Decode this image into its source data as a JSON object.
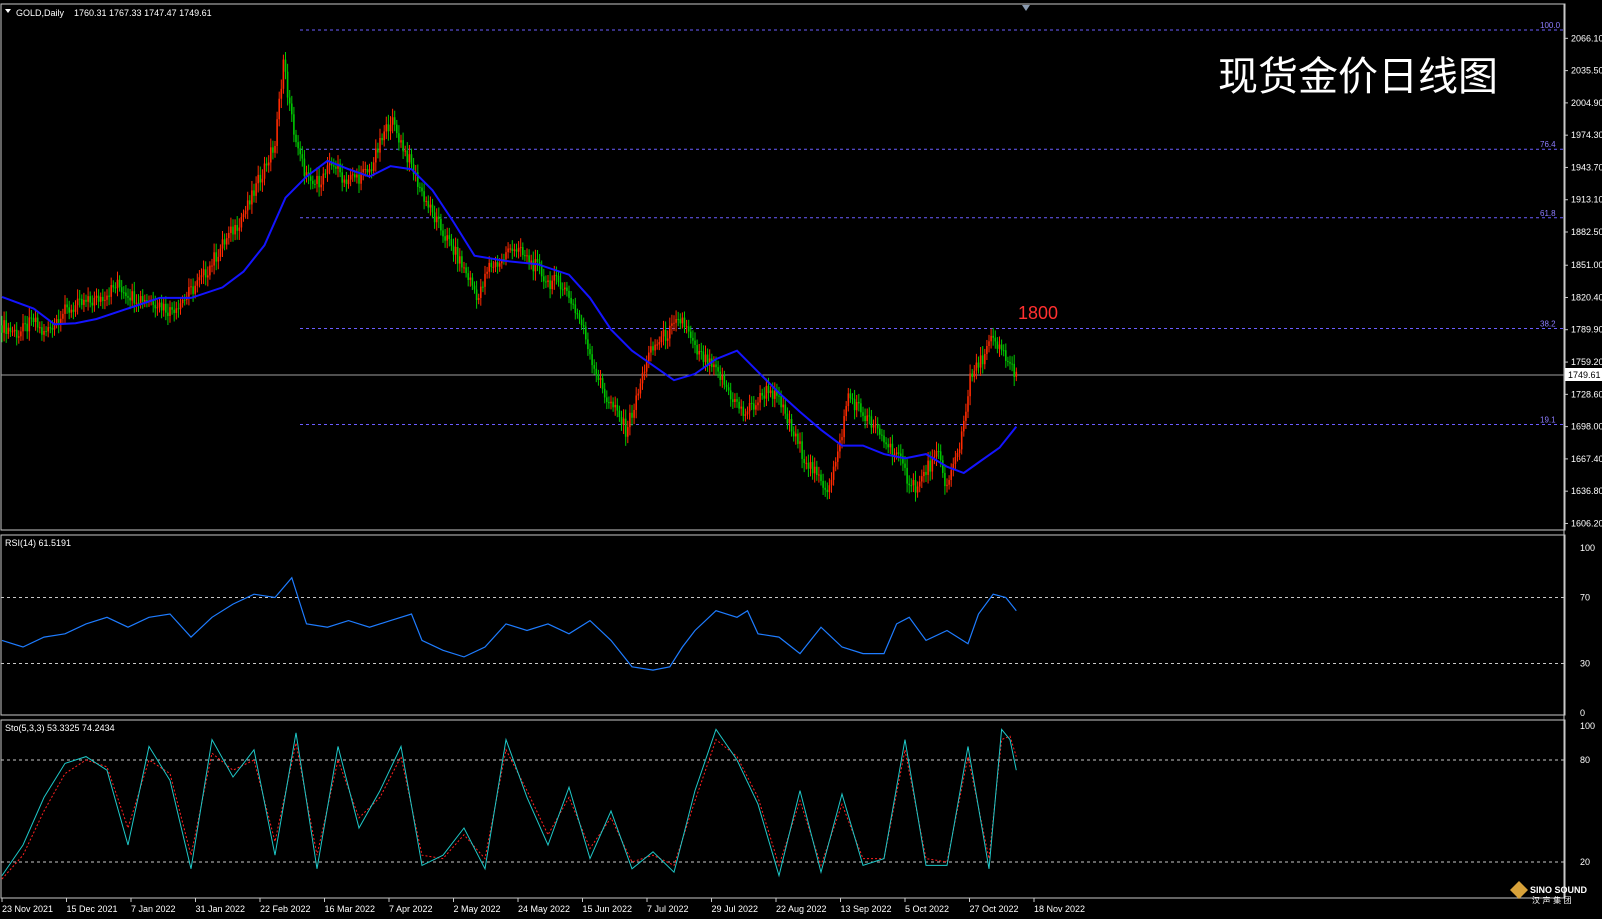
{
  "header": {
    "title": "GOLD,Daily",
    "ohlc": "1760.31 1767.33 1747.47 1749.61"
  },
  "overlay_title": "现货金价日线图",
  "annotation": "1800",
  "current_price": "1749.61",
  "rsi_panel": {
    "label": "RSI(14) 61.5191",
    "levels": [
      "100",
      "70",
      "30",
      "0"
    ]
  },
  "stoch_panel": {
    "label": "Sto(5,3,3) 53.3325 74.2434",
    "levels": [
      "100",
      "80",
      "20"
    ]
  },
  "logo": {
    "mark": "SINO SOUND",
    "subtitle": "汉 声 集 团"
  },
  "colors": {
    "bull": "#ff2a00",
    "bear": "#00c800",
    "ma": "#1414ff",
    "rsi": "#1e7cff",
    "stoch_main": "#1ec8c8",
    "stoch_signal": "#ff2020",
    "fib": "#8d7dff",
    "annotation": "#ff3030"
  },
  "chart_data": [
    {
      "type": "candlestick",
      "title": "GOLD,Daily",
      "x_labels": [
        "23 Nov 2021",
        "15 Dec 2021",
        "7 Jan 2022",
        "31 Jan 2022",
        "22 Feb 2022",
        "16 Mar 2022",
        "7 Apr 2022",
        "2 May 2022",
        "24 May 2022",
        "15 Jun 2022",
        "7 Jul 2022",
        "29 Jul 2022",
        "22 Aug 2022",
        "13 Sep 2022",
        "5 Oct 2022",
        "27 Oct 2022",
        "18 Nov 2022"
      ],
      "y_ticks": [
        "2066.10",
        "2035.50",
        "2004.90",
        "1974.30",
        "1943.70",
        "1913.10",
        "1882.50",
        "1851.00",
        "1820.40",
        "1789.90",
        "1759.20",
        "1728.60",
        "1698.00",
        "1667.40",
        "1636.80",
        "1606.20"
      ],
      "ylim": [
        1600,
        2074
      ],
      "close_path": [
        [
          0,
          1794
        ],
        [
          8,
          1786
        ],
        [
          15,
          1798
        ],
        [
          20,
          1785
        ],
        [
          28,
          1805
        ],
        [
          35,
          1812
        ],
        [
          45,
          1818
        ],
        [
          55,
          1832
        ],
        [
          62,
          1822
        ],
        [
          72,
          1818
        ],
        [
          80,
          1808
        ],
        [
          88,
          1822
        ],
        [
          95,
          1838
        ],
        [
          105,
          1870
        ],
        [
          112,
          1890
        ],
        [
          118,
          1910
        ],
        [
          124,
          1940
        ],
        [
          130,
          1965
        ],
        [
          134,
          2045
        ],
        [
          137,
          2000
        ],
        [
          141,
          1958
        ],
        [
          147,
          1925
        ],
        [
          153,
          1935
        ],
        [
          158,
          1948
        ],
        [
          163,
          1932
        ],
        [
          170,
          1935
        ],
        [
          175,
          1940
        ],
        [
          180,
          1965
        ],
        [
          185,
          1990
        ],
        [
          190,
          1968
        ],
        [
          195,
          1945
        ],
        [
          200,
          1920
        ],
        [
          206,
          1895
        ],
        [
          212,
          1875
        ],
        [
          217,
          1858
        ],
        [
          222,
          1840
        ],
        [
          227,
          1820
        ],
        [
          232,
          1850
        ],
        [
          238,
          1855
        ],
        [
          243,
          1870
        ],
        [
          248,
          1860
        ],
        [
          254,
          1850
        ],
        [
          260,
          1835
        ],
        [
          266,
          1835
        ],
        [
          271,
          1818
        ],
        [
          276,
          1795
        ],
        [
          282,
          1755
        ],
        [
          287,
          1728
        ],
        [
          293,
          1710
        ],
        [
          297,
          1695
        ],
        [
          302,
          1722
        ],
        [
          307,
          1762
        ],
        [
          313,
          1780
        ],
        [
          319,
          1790
        ],
        [
          324,
          1800
        ],
        [
          330,
          1770
        ],
        [
          336,
          1758
        ],
        [
          342,
          1745
        ],
        [
          348,
          1725
        ],
        [
          353,
          1710
        ],
        [
          359,
          1720
        ],
        [
          365,
          1735
        ],
        [
          371,
          1718
        ],
        [
          377,
          1690
        ],
        [
          382,
          1670
        ],
        [
          388,
          1650
        ],
        [
          393,
          1640
        ],
        [
          398,
          1670
        ],
        [
          403,
          1728
        ],
        [
          408,
          1715
        ],
        [
          414,
          1700
        ],
        [
          420,
          1685
        ],
        [
          426,
          1672
        ],
        [
          431,
          1650
        ],
        [
          436,
          1640
        ],
        [
          441,
          1660
        ],
        [
          446,
          1670
        ],
        [
          450,
          1640
        ],
        [
          456,
          1680
        ],
        [
          461,
          1742
        ],
        [
          466,
          1760
        ],
        [
          471,
          1780
        ],
        [
          474,
          1772
        ],
        [
          477,
          1768
        ],
        [
          480,
          1755
        ],
        [
          483,
          1750
        ]
      ],
      "ma_path": [
        [
          0,
          1821
        ],
        [
          15,
          1810
        ],
        [
          25,
          1795
        ],
        [
          35,
          1796
        ],
        [
          45,
          1800
        ],
        [
          60,
          1810
        ],
        [
          75,
          1820
        ],
        [
          90,
          1820
        ],
        [
          105,
          1830
        ],
        [
          115,
          1845
        ],
        [
          125,
          1870
        ],
        [
          135,
          1915
        ],
        [
          145,
          1935
        ],
        [
          155,
          1950
        ],
        [
          165,
          1942
        ],
        [
          175,
          1935
        ],
        [
          185,
          1945
        ],
        [
          195,
          1942
        ],
        [
          205,
          1922
        ],
        [
          215,
          1892
        ],
        [
          225,
          1860
        ],
        [
          240,
          1855
        ],
        [
          255,
          1852
        ],
        [
          270,
          1842
        ],
        [
          280,
          1820
        ],
        [
          290,
          1790
        ],
        [
          300,
          1770
        ],
        [
          310,
          1756
        ],
        [
          320,
          1742
        ],
        [
          330,
          1748
        ],
        [
          340,
          1762
        ],
        [
          350,
          1770
        ],
        [
          360,
          1750
        ],
        [
          370,
          1730
        ],
        [
          380,
          1712
        ],
        [
          390,
          1695
        ],
        [
          400,
          1680
        ],
        [
          410,
          1680
        ],
        [
          420,
          1672
        ],
        [
          430,
          1668
        ],
        [
          440,
          1672
        ],
        [
          450,
          1660
        ],
        [
          458,
          1654
        ],
        [
          465,
          1664
        ],
        [
          475,
          1678
        ],
        [
          483,
          1698
        ]
      ],
      "fibonacci": [
        {
          "level": "100.0",
          "price": 2074
        },
        {
          "level": "76.4",
          "price": 1961
        },
        {
          "level": "61.8",
          "price": 1896
        },
        {
          "level": "38.2",
          "price": 1791
        },
        {
          "level": "19.1",
          "price": 1700
        }
      ]
    },
    {
      "type": "line",
      "title": "RSI(14) 61.5191",
      "ylim": [
        0,
        100
      ],
      "levels": [
        70,
        30
      ],
      "values": [
        [
          0,
          44
        ],
        [
          10,
          40
        ],
        [
          20,
          46
        ],
        [
          30,
          48
        ],
        [
          40,
          54
        ],
        [
          50,
          58
        ],
        [
          60,
          52
        ],
        [
          70,
          58
        ],
        [
          80,
          60
        ],
        [
          90,
          46
        ],
        [
          100,
          58
        ],
        [
          110,
          66
        ],
        [
          120,
          72
        ],
        [
          130,
          70
        ],
        [
          138,
          82
        ],
        [
          145,
          54
        ],
        [
          155,
          52
        ],
        [
          165,
          56
        ],
        [
          175,
          52
        ],
        [
          185,
          56
        ],
        [
          195,
          60
        ],
        [
          200,
          44
        ],
        [
          210,
          38
        ],
        [
          220,
          34
        ],
        [
          230,
          40
        ],
        [
          240,
          54
        ],
        [
          250,
          50
        ],
        [
          260,
          54
        ],
        [
          270,
          48
        ],
        [
          280,
          56
        ],
        [
          290,
          44
        ],
        [
          300,
          28
        ],
        [
          310,
          26
        ],
        [
          318,
          28
        ],
        [
          324,
          40
        ],
        [
          330,
          50
        ],
        [
          340,
          62
        ],
        [
          350,
          58
        ],
        [
          355,
          62
        ],
        [
          360,
          48
        ],
        [
          370,
          46
        ],
        [
          380,
          36
        ],
        [
          390,
          52
        ],
        [
          400,
          40
        ],
        [
          410,
          36
        ],
        [
          420,
          36
        ],
        [
          426,
          54
        ],
        [
          432,
          58
        ],
        [
          440,
          44
        ],
        [
          450,
          50
        ],
        [
          460,
          42
        ],
        [
          465,
          60
        ],
        [
          472,
          72
        ],
        [
          478,
          70
        ],
        [
          483,
          62
        ]
      ]
    },
    {
      "type": "line",
      "title": "Sto(5,3,3) 53.3325 74.2434",
      "ylim": [
        0,
        100
      ],
      "levels": [
        80,
        20
      ],
      "series": [
        {
          "name": "main",
          "values": [
            [
              0,
              12
            ],
            [
              10,
              30
            ],
            [
              20,
              58
            ],
            [
              30,
              78
            ],
            [
              40,
              82
            ],
            [
              50,
              74
            ],
            [
              60,
              30
            ],
            [
              70,
              88
            ],
            [
              80,
              68
            ],
            [
              90,
              16
            ],
            [
              100,
              92
            ],
            [
              110,
              70
            ],
            [
              120,
              86
            ],
            [
              130,
              24
            ],
            [
              140,
              96
            ],
            [
              150,
              16
            ],
            [
              160,
              88
            ],
            [
              170,
              40
            ],
            [
              180,
              62
            ],
            [
              190,
              88
            ],
            [
              200,
              18
            ],
            [
              210,
              24
            ],
            [
              220,
              40
            ],
            [
              230,
              16
            ],
            [
              240,
              92
            ],
            [
              250,
              58
            ],
            [
              260,
              30
            ],
            [
              270,
              64
            ],
            [
              280,
              22
            ],
            [
              290,
              50
            ],
            [
              300,
              16
            ],
            [
              310,
              26
            ],
            [
              320,
              14
            ],
            [
              330,
              62
            ],
            [
              340,
              98
            ],
            [
              350,
              80
            ],
            [
              360,
              54
            ],
            [
              370,
              12
            ],
            [
              380,
              62
            ],
            [
              390,
              14
            ],
            [
              400,
              60
            ],
            [
              410,
              18
            ],
            [
              420,
              22
            ],
            [
              430,
              92
            ],
            [
              440,
              18
            ],
            [
              450,
              18
            ],
            [
              460,
              88
            ],
            [
              470,
              16
            ],
            [
              476,
              98
            ],
            [
              480,
              92
            ],
            [
              483,
              74
            ]
          ]
        },
        {
          "name": "signal",
          "values": [
            [
              0,
              10
            ],
            [
              10,
              24
            ],
            [
              20,
              50
            ],
            [
              30,
              72
            ],
            [
              40,
              80
            ],
            [
              50,
              76
            ],
            [
              60,
              40
            ],
            [
              70,
              80
            ],
            [
              80,
              72
            ],
            [
              90,
              24
            ],
            [
              100,
              84
            ],
            [
              110,
              74
            ],
            [
              120,
              80
            ],
            [
              130,
              32
            ],
            [
              140,
              90
            ],
            [
              150,
              24
            ],
            [
              160,
              80
            ],
            [
              170,
              46
            ],
            [
              180,
              58
            ],
            [
              190,
              82
            ],
            [
              200,
              24
            ],
            [
              210,
              22
            ],
            [
              220,
              36
            ],
            [
              230,
              22
            ],
            [
              240,
              86
            ],
            [
              250,
              62
            ],
            [
              260,
              36
            ],
            [
              270,
              58
            ],
            [
              280,
              28
            ],
            [
              290,
              46
            ],
            [
              300,
              20
            ],
            [
              310,
              24
            ],
            [
              320,
              18
            ],
            [
              330,
              56
            ],
            [
              340,
              92
            ],
            [
              350,
              82
            ],
            [
              360,
              58
            ],
            [
              370,
              18
            ],
            [
              380,
              56
            ],
            [
              390,
              18
            ],
            [
              400,
              54
            ],
            [
              410,
              22
            ],
            [
              420,
              22
            ],
            [
              430,
              86
            ],
            [
              440,
              22
            ],
            [
              450,
              20
            ],
            [
              460,
              82
            ],
            [
              470,
              22
            ],
            [
              476,
              92
            ],
            [
              480,
              94
            ],
            [
              483,
              82
            ]
          ]
        }
      ]
    }
  ]
}
